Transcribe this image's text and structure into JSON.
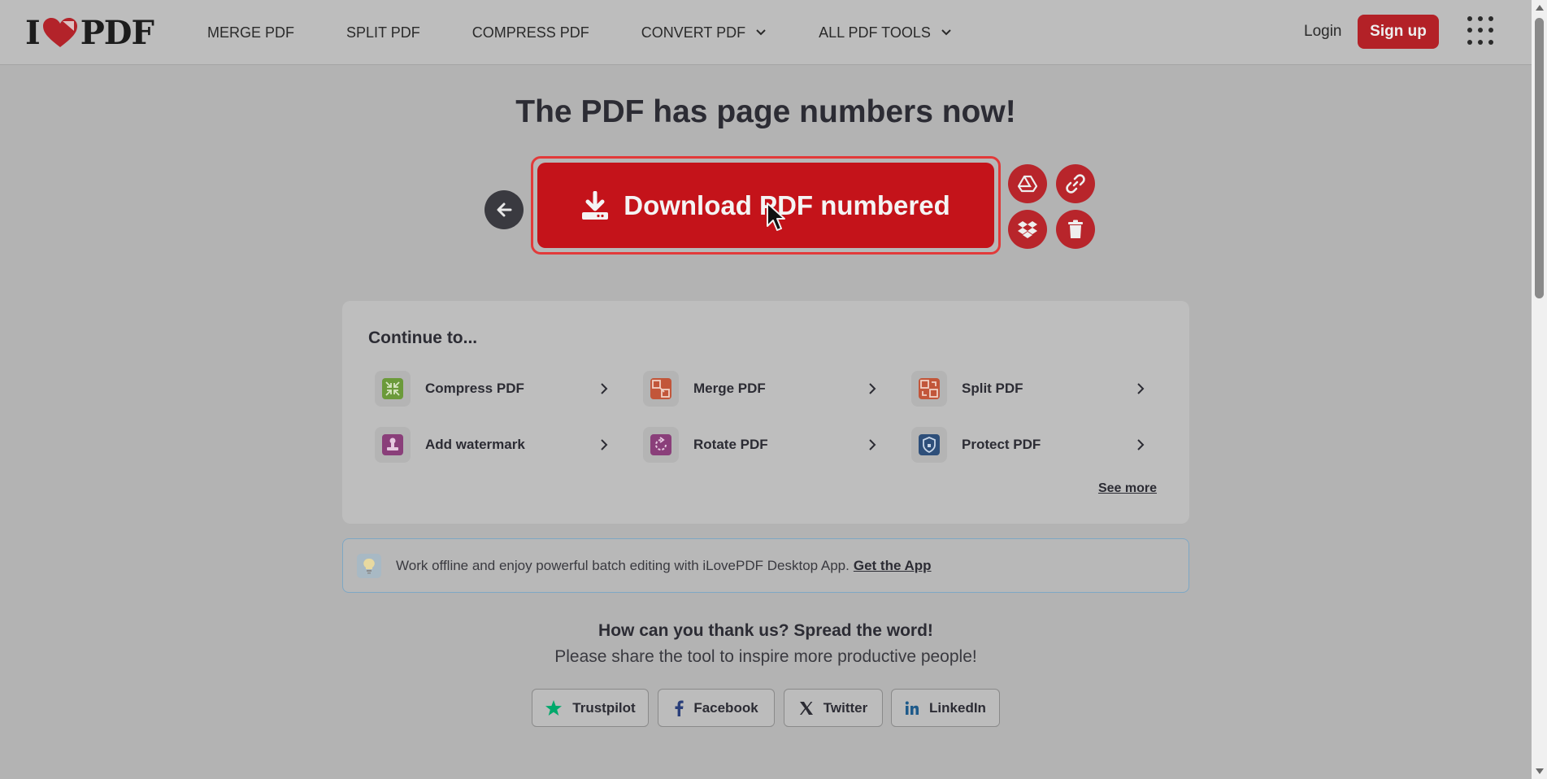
{
  "header": {
    "logo": {
      "left": "I",
      "right": "PDF"
    },
    "nav": [
      {
        "label": "MERGE PDF",
        "dropdown": false
      },
      {
        "label": "SPLIT PDF",
        "dropdown": false
      },
      {
        "label": "COMPRESS PDF",
        "dropdown": false
      },
      {
        "label": "CONVERT PDF",
        "dropdown": true
      },
      {
        "label": "ALL PDF TOOLS",
        "dropdown": true
      }
    ],
    "login_label": "Login",
    "signup_label": "Sign up"
  },
  "main": {
    "title": "The PDF has page numbers now!",
    "download_label": "Download PDF numbered",
    "action_icons": [
      "arrow-left-icon",
      "google-drive-icon",
      "link-icon",
      "dropbox-icon",
      "trash-icon"
    ]
  },
  "continue": {
    "heading": "Continue to...",
    "tools": [
      {
        "label": "Compress PDF",
        "icon": "compress-icon",
        "color": "#6b9a3a"
      },
      {
        "label": "Merge PDF",
        "icon": "merge-icon",
        "color": "#c2563a"
      },
      {
        "label": "Split PDF",
        "icon": "split-icon",
        "color": "#c2563a"
      },
      {
        "label": "Add watermark",
        "icon": "watermark-icon",
        "color": "#8a3f7a"
      },
      {
        "label": "Rotate PDF",
        "icon": "rotate-icon",
        "color": "#8a3f7a"
      },
      {
        "label": "Protect PDF",
        "icon": "shield-icon",
        "color": "#2e4f7a"
      }
    ],
    "see_more": "See more"
  },
  "banner": {
    "text": "Work offline and enjoy powerful batch editing with iLovePDF Desktop App.",
    "link": "Get the App"
  },
  "share": {
    "heading": "How can you thank us? Spread the word!",
    "subheading": "Please share the tool to inspire more productive people!",
    "buttons": [
      {
        "label": "Trustpilot",
        "icon": "star-icon",
        "color": "#00a86b"
      },
      {
        "label": "Facebook",
        "icon": "facebook-icon",
        "color": "#2a3f7a"
      },
      {
        "label": "Twitter",
        "icon": "x-icon",
        "color": "#2c2c34"
      },
      {
        "label": "LinkedIn",
        "icon": "linkedin-icon",
        "color": "#1e5a8a"
      }
    ]
  },
  "colors": {
    "brand_red": "#c4131a",
    "overlay_bg": "#b3b3b3"
  }
}
